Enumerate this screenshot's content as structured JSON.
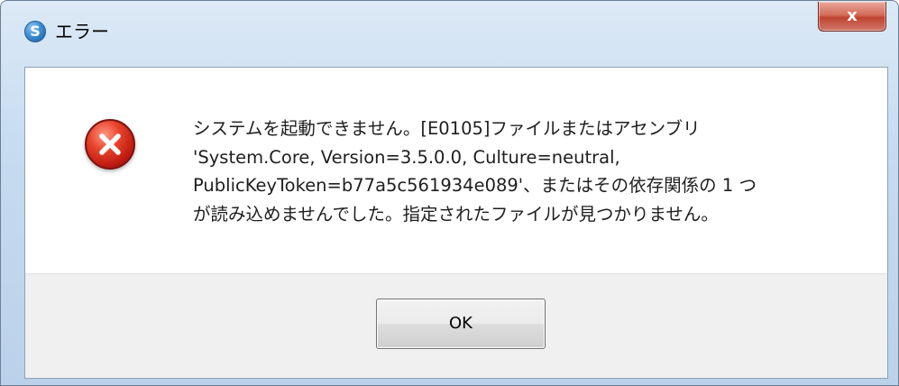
{
  "window": {
    "title": "エラー",
    "app_icon_glyph": "S",
    "close_glyph": "x"
  },
  "dialog": {
    "icon": "error-x-icon",
    "message_lines": [
      "システムを起動できません。[E0105]ファイルまたはアセンブリ",
      "'System.Core, Version=3.5.0.0, Culture=neutral,",
      "PublicKeyToken=b77a5c561934e089'、またはその依存関係の 1 つ",
      "が読み込めませんでした。指定されたファイルが見つかりません。"
    ],
    "ok_label": "OK"
  },
  "colors": {
    "error_red": "#c8231a",
    "title_bar": "#c6dbf0",
    "close_red": "#c04431"
  }
}
